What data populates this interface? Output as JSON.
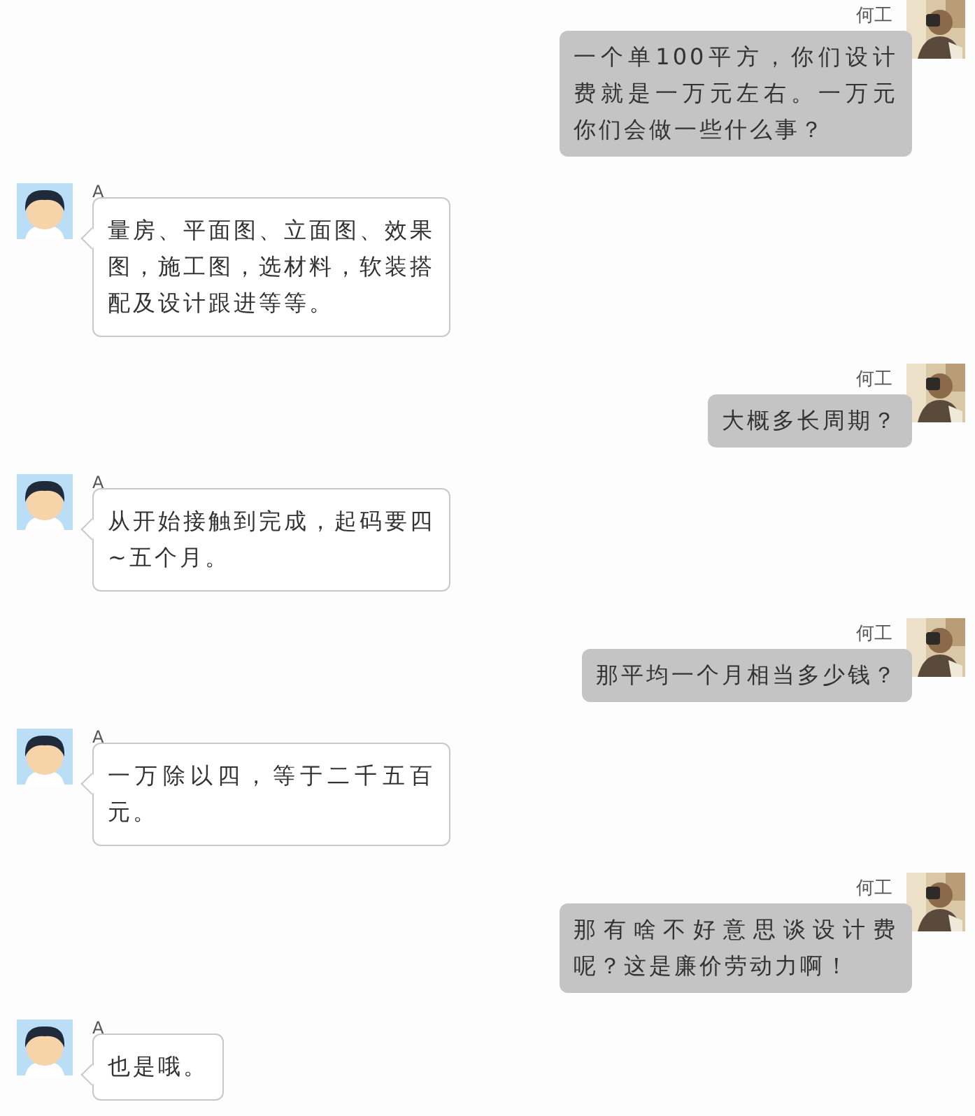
{
  "messages": [
    {
      "kind": "right",
      "sender": "何工",
      "text": "一个单100平方，你们设计费就是一万元左右。一万元你们会做一些什么事？"
    },
    {
      "kind": "left",
      "sender": "A",
      "text": "量房、平面图、立面图、效果图，施工图，选材料，软装搭配及设计跟进等等。"
    },
    {
      "kind": "right",
      "sender": "何工",
      "text": "大概多长周期？"
    },
    {
      "kind": "left",
      "sender": "A",
      "text": "从开始接触到完成，起码要四~五个月。"
    },
    {
      "kind": "right",
      "sender": "何工",
      "text": "那平均一个月相当多少钱？"
    },
    {
      "kind": "left",
      "sender": "A",
      "text": "一万除以四，等于二千五百元。"
    },
    {
      "kind": "right",
      "sender": "何工",
      "text": "那有啥不好意思谈设计费呢？这是廉价劳动力啊！"
    },
    {
      "kind": "left",
      "sender": "A",
      "text": "也是哦。"
    }
  ]
}
